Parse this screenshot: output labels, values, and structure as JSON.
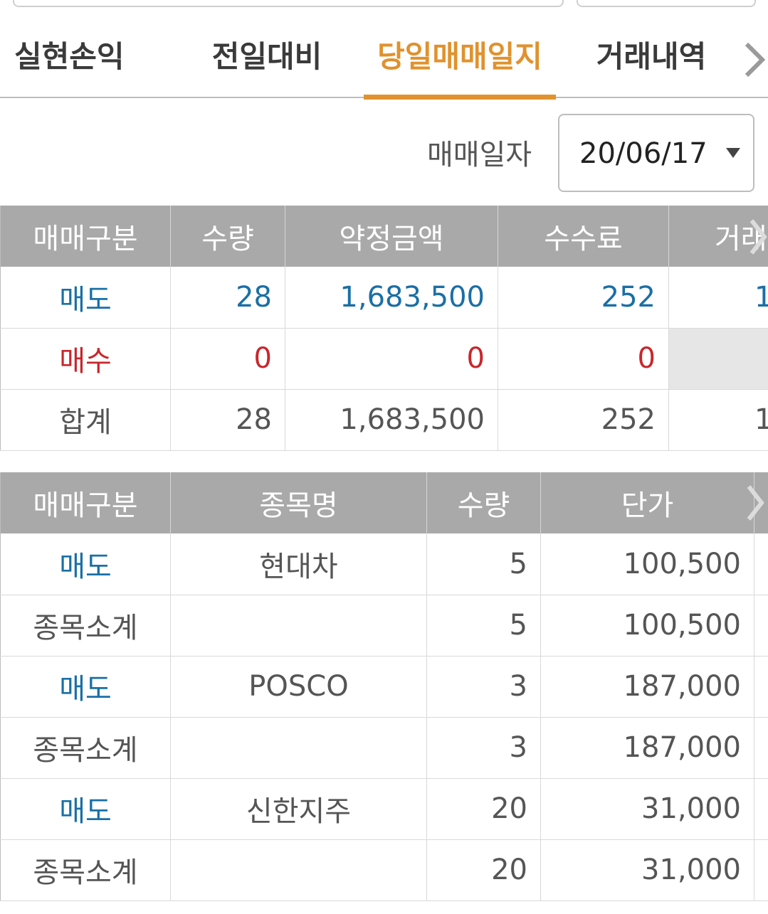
{
  "tabs": [
    {
      "label": "실현손익"
    },
    {
      "label": "전일대비"
    },
    {
      "label": "당일매매일지"
    },
    {
      "label": "거래내역"
    }
  ],
  "active_tab": "당일매매일지",
  "accent_color": "#e0922e",
  "colors": {
    "sell": "#1a6fa6",
    "buy": "#c8262c",
    "header_bg": "#a9a9a9"
  },
  "date_filter": {
    "label": "매매일자",
    "value": "20/06/17"
  },
  "summary": {
    "headers": [
      "매매구분",
      "수량",
      "약정금액",
      "수수료",
      "거래"
    ],
    "rows": [
      {
        "type": "매도",
        "qty": "28",
        "amount": "1,683,500",
        "fee": "252",
        "more": "1"
      },
      {
        "type": "매수",
        "qty": "0",
        "amount": "0",
        "fee": "0",
        "more": ""
      },
      {
        "type": "합계",
        "qty": "28",
        "amount": "1,683,500",
        "fee": "252",
        "more": "1"
      }
    ]
  },
  "detail": {
    "headers": [
      "매매구분",
      "종목명",
      "수량",
      "단가"
    ],
    "rows": [
      {
        "type": "매도",
        "name": "현대차",
        "qty": "5",
        "price": "100,500"
      },
      {
        "type": "종목소계",
        "name": "",
        "qty": "5",
        "price": "100,500"
      },
      {
        "type": "매도",
        "name": "POSCO",
        "qty": "3",
        "price": "187,000"
      },
      {
        "type": "종목소계",
        "name": "",
        "qty": "3",
        "price": "187,000"
      },
      {
        "type": "매도",
        "name": "신한지주",
        "qty": "20",
        "price": "31,000"
      },
      {
        "type": "종목소계",
        "name": "",
        "qty": "20",
        "price": "31,000"
      }
    ]
  }
}
